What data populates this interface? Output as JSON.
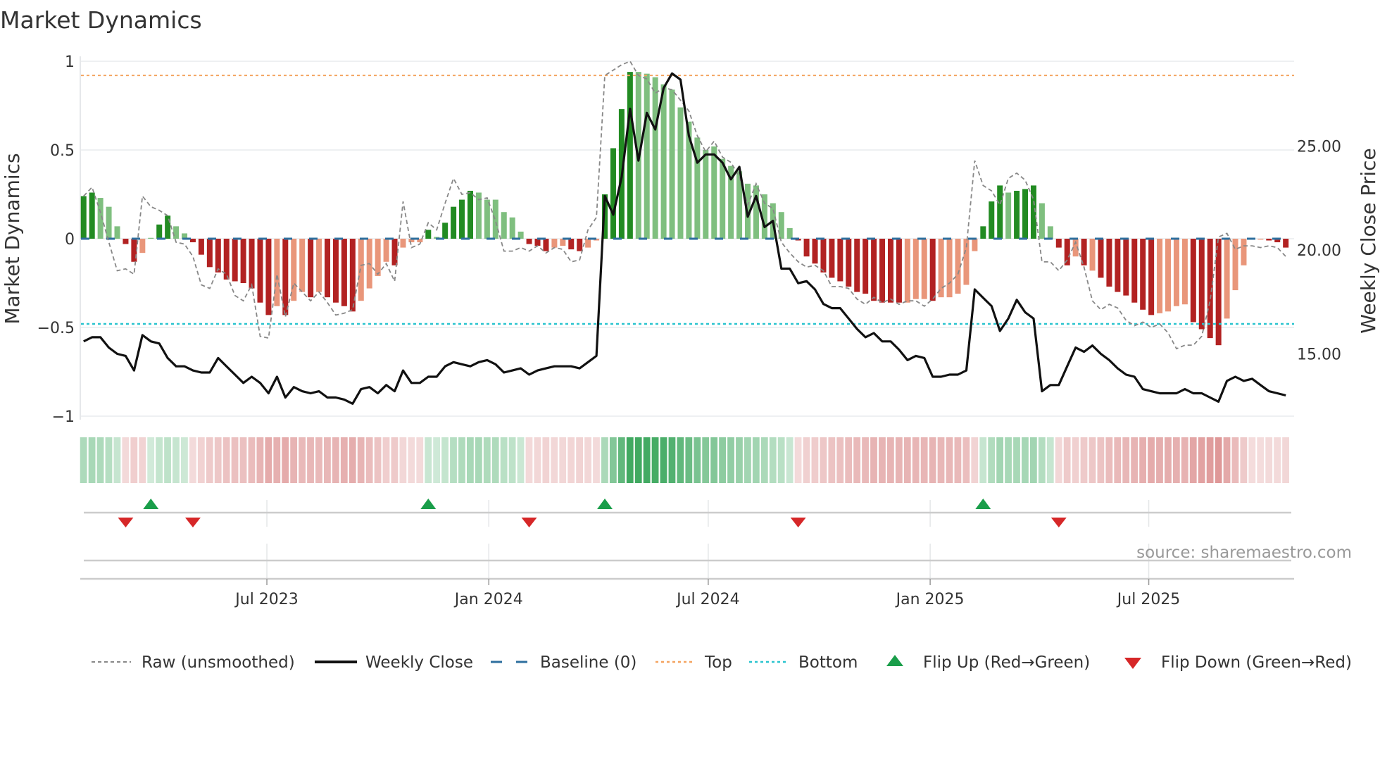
{
  "title": "Market Dynamics",
  "source": "source: sharemaestro.com",
  "colors": {
    "pos_dark": "#228b22",
    "pos_light": "#7fbf7f",
    "neg_dark": "#b22222",
    "neg_light": "#e9967a",
    "raw": "#888888",
    "close": "#111111",
    "baseline": "#2e6f9e",
    "top": "#f4a460",
    "bottom": "#2bc4cf",
    "flip_up": "#1a9e4a",
    "flip_down": "#d62728"
  },
  "legend": [
    {
      "key": "raw",
      "label": "Raw (unsmoothed)"
    },
    {
      "key": "close",
      "label": "Weekly Close"
    },
    {
      "key": "baseline",
      "label": "Baseline (0)"
    },
    {
      "key": "top",
      "label": "Top"
    },
    {
      "key": "bottom",
      "label": "Bottom"
    },
    {
      "key": "flip_up",
      "label": "Flip Up (Red→Green)"
    },
    {
      "key": "flip_down",
      "label": "Flip Down (Green→Red)"
    }
  ],
  "chart_data": {
    "type": "bar",
    "title": "Market Dynamics",
    "ylabel": "Market Dynamics",
    "y2label": "Weekly Close Price",
    "ylim": [
      -1,
      1
    ],
    "y2lim": [
      11.3,
      28.5
    ],
    "yticks": [
      {
        "v": 1,
        "label": "1"
      },
      {
        "v": 0.5,
        "label": "0.5"
      },
      {
        "v": 0,
        "label": "0"
      },
      {
        "v": -0.5,
        "label": "−0.5"
      },
      {
        "v": -1,
        "label": "−1"
      }
    ],
    "y2ticks": [
      {
        "v": 25,
        "label": "25.00"
      },
      {
        "v": 20,
        "label": "20.00"
      },
      {
        "v": 15,
        "label": "15.00"
      }
    ],
    "xticks": [
      {
        "week": 21.8,
        "label": "Jul 2023"
      },
      {
        "week": 48.2,
        "label": "Jan 2024"
      },
      {
        "week": 74.3,
        "label": "Jul 2024"
      },
      {
        "week": 100.7,
        "label": "Jan 2025"
      },
      {
        "week": 126.7,
        "label": "Jul 2025"
      }
    ],
    "top_level": 0.92,
    "bottom_level": -0.48,
    "baseline": 0,
    "bar_values": [
      0.24,
      0.26,
      0.23,
      0.18,
      0.07,
      -0.03,
      -0.13,
      -0.08,
      0.005,
      0.08,
      0.13,
      0.07,
      0.03,
      -0.02,
      -0.09,
      -0.16,
      -0.19,
      -0.23,
      -0.24,
      -0.25,
      -0.28,
      -0.36,
      -0.43,
      -0.38,
      -0.43,
      -0.35,
      -0.3,
      -0.33,
      -0.3,
      -0.33,
      -0.36,
      -0.38,
      -0.41,
      -0.35,
      -0.28,
      -0.21,
      -0.13,
      -0.15,
      -0.05,
      -0.02,
      -0.02,
      0.05,
      0.01,
      0.09,
      0.18,
      0.22,
      0.27,
      0.26,
      0.22,
      0.22,
      0.15,
      0.12,
      0.04,
      -0.03,
      -0.04,
      -0.07,
      -0.05,
      -0.04,
      -0.06,
      -0.07,
      -0.05,
      -0.01,
      0.25,
      0.51,
      0.73,
      0.94,
      0.94,
      0.93,
      0.91,
      0.87,
      0.84,
      0.74,
      0.66,
      0.57,
      0.5,
      0.52,
      0.45,
      0.41,
      0.38,
      0.31,
      0.3,
      0.25,
      0.2,
      0.15,
      0.06,
      -0.01,
      -0.1,
      -0.14,
      -0.19,
      -0.22,
      -0.24,
      -0.27,
      -0.3,
      -0.31,
      -0.35,
      -0.36,
      -0.36,
      -0.36,
      -0.36,
      -0.34,
      -0.34,
      -0.35,
      -0.33,
      -0.33,
      -0.31,
      -0.26,
      -0.07,
      0.07,
      0.21,
      0.3,
      0.26,
      0.27,
      0.28,
      0.3,
      0.2,
      0.07,
      -0.05,
      -0.15,
      -0.1,
      -0.15,
      -0.18,
      -0.22,
      -0.27,
      -0.3,
      -0.32,
      -0.36,
      -0.4,
      -0.43,
      -0.42,
      -0.41,
      -0.38,
      -0.37,
      -0.47,
      -0.51,
      -0.56,
      -0.6,
      -0.45,
      -0.29,
      -0.15,
      -0.005,
      -0.005,
      -0.01,
      -0.02,
      -0.05
    ],
    "bar_tones": "DDLLLDDLLDDLLDDDDDDDDDDLDLLDLDDDDLLLLDLLLDLDDDDLLLLLLDDDLLDDLLDDDDLLLLLLLLLLLLLLLLLLLDDDDDDDDDDDDDLLLDLLLLLDDDLDDDLLDDLDLDDDDDDDLLLLDDDDLLLLLDDD",
    "raw_values": [
      0.24,
      0.29,
      0.15,
      -0.02,
      -0.18,
      -0.17,
      -0.2,
      0.24,
      0.18,
      0.16,
      0.13,
      -0.02,
      -0.03,
      -0.1,
      -0.26,
      -0.28,
      -0.17,
      -0.2,
      -0.32,
      -0.35,
      -0.26,
      -0.55,
      -0.56,
      -0.2,
      -0.44,
      -0.25,
      -0.3,
      -0.35,
      -0.3,
      -0.36,
      -0.43,
      -0.42,
      -0.4,
      -0.15,
      -0.14,
      -0.2,
      -0.14,
      -0.24,
      0.21,
      -0.05,
      -0.03,
      0.09,
      0.05,
      0.2,
      0.34,
      0.25,
      0.26,
      0.22,
      0.23,
      0.1,
      -0.07,
      -0.07,
      -0.05,
      -0.07,
      -0.04,
      -0.08,
      -0.05,
      -0.06,
      -0.13,
      -0.12,
      0.05,
      0.12,
      0.92,
      0.95,
      0.98,
      1.0,
      0.92,
      0.9,
      0.82,
      0.85,
      0.84,
      0.78,
      0.72,
      0.58,
      0.49,
      0.55,
      0.46,
      0.43,
      0.35,
      0.19,
      0.31,
      0.2,
      0.17,
      -0.02,
      -0.08,
      -0.13,
      -0.16,
      -0.15,
      -0.18,
      -0.27,
      -0.27,
      -0.28,
      -0.34,
      -0.37,
      -0.33,
      -0.36,
      -0.34,
      -0.37,
      -0.35,
      -0.35,
      -0.38,
      -0.34,
      -0.28,
      -0.25,
      -0.2,
      -0.05,
      0.44,
      0.3,
      0.27,
      0.19,
      0.34,
      0.37,
      0.33,
      0.22,
      -0.13,
      -0.13,
      -0.18,
      -0.12,
      -0.02,
      -0.16,
      -0.35,
      -0.4,
      -0.37,
      -0.39,
      -0.46,
      -0.49,
      -0.47,
      -0.5,
      -0.48,
      -0.53,
      -0.62,
      -0.6,
      -0.6,
      -0.55,
      -0.35,
      0.01,
      0.03,
      -0.06,
      -0.04,
      -0.04,
      -0.05,
      -0.04,
      -0.05,
      -0.1
    ],
    "close_values": [
      15.6,
      15.8,
      15.8,
      15.3,
      15.0,
      14.9,
      14.2,
      15.9,
      15.6,
      15.5,
      14.8,
      14.4,
      14.4,
      14.2,
      14.1,
      14.1,
      14.8,
      14.4,
      14.0,
      13.6,
      13.9,
      13.6,
      13.1,
      13.9,
      12.9,
      13.4,
      13.2,
      13.1,
      13.2,
      12.9,
      12.9,
      12.8,
      12.6,
      13.3,
      13.4,
      13.1,
      13.5,
      13.2,
      14.2,
      13.6,
      13.6,
      13.9,
      13.9,
      14.4,
      14.6,
      14.5,
      14.4,
      14.6,
      14.7,
      14.5,
      14.1,
      14.2,
      14.3,
      14.0,
      14.2,
      14.3,
      14.4,
      14.4,
      14.4,
      14.3,
      14.6,
      14.9,
      22.6,
      21.7,
      23.5,
      26.8,
      24.3,
      26.6,
      25.8,
      27.8,
      28.5,
      28.2,
      25.5,
      24.2,
      24.6,
      24.6,
      24.2,
      23.4,
      24.0,
      21.6,
      22.6,
      21.1,
      21.4,
      19.1,
      19.1,
      18.4,
      18.5,
      18.1,
      17.4,
      17.2,
      17.2,
      16.7,
      16.2,
      15.8,
      16.0,
      15.6,
      15.6,
      15.2,
      14.7,
      14.9,
      14.8,
      13.9,
      13.9,
      14.0,
      14.0,
      14.2,
      18.1,
      17.7,
      17.3,
      16.1,
      16.7,
      17.6,
      17.0,
      16.7,
      13.2,
      13.5,
      13.5,
      14.4,
      15.3,
      15.1,
      15.4,
      15.0,
      14.7,
      14.3,
      14.0,
      13.9,
      13.3,
      13.2,
      13.1,
      13.1,
      13.1,
      13.3,
      13.1,
      13.1,
      12.9,
      12.7,
      13.7,
      13.9,
      13.7,
      13.8,
      13.5,
      13.2,
      13.1,
      13.0
    ],
    "flip_up_weeks": [
      8,
      41,
      62,
      107
    ],
    "flip_down_weeks": [
      5,
      13,
      53,
      85,
      116
    ],
    "grid": true,
    "legend_position": "bottom"
  }
}
